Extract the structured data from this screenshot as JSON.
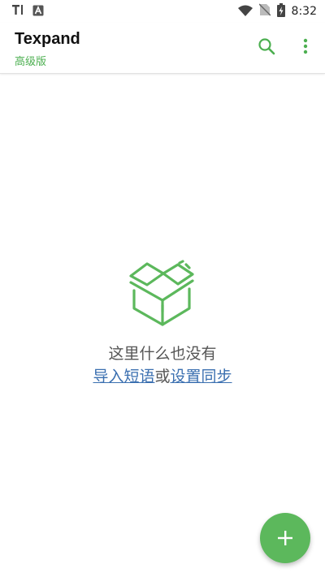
{
  "status_bar": {
    "time": "8:32",
    "icons": [
      "text-notification-icon",
      "accessibility-notification-icon",
      "wifi-icon",
      "no-sim-icon",
      "battery-charging-icon"
    ]
  },
  "app_bar": {
    "title": "Texpand",
    "subtitle": "高级版",
    "actions": [
      "search-icon",
      "more-vert-icon"
    ]
  },
  "empty_state": {
    "icon": "open-box-icon",
    "message": "这里什么也没有",
    "import_link": "导入短语",
    "separator": "或",
    "sync_link": "设置同步"
  },
  "fab": {
    "icon": "plus-icon"
  },
  "colors": {
    "accent": "#4caf50",
    "fab": "#5cb85c",
    "link": "#3a6fb0"
  }
}
